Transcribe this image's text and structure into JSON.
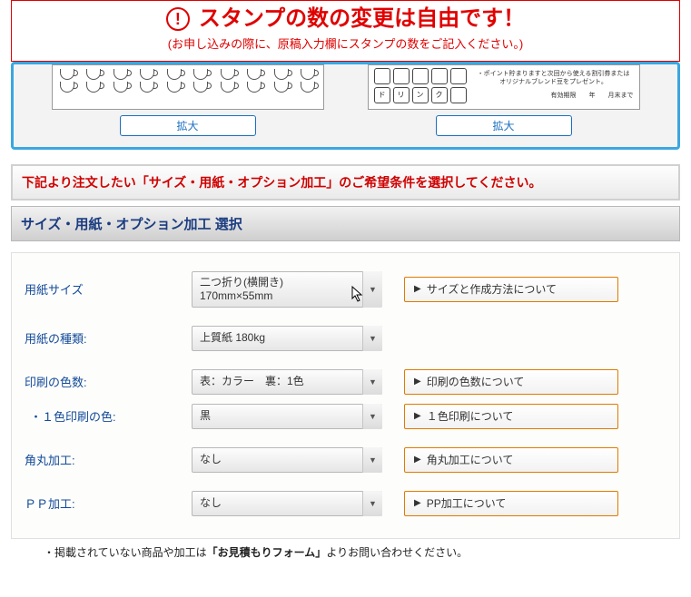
{
  "notice": {
    "title": "スタンプの数の変更は自由です！",
    "subtitle": "(お申し込みの際に、原稿入力欄にスタンプの数をご記入ください。)"
  },
  "preview": {
    "zoom_label": "拡大",
    "card2_squares": [
      "",
      "",
      "",
      "",
      "",
      "ド",
      "リ",
      "ン",
      "ク",
      ""
    ],
    "card2_desc_line1": "・ポイント貯まりますと次回から使える割引券または",
    "card2_desc_line2": "オリジナルブレンド豆をプレゼント。",
    "card2_desc_line3": "有効期限　　年　　月末まで"
  },
  "instruction": "下記より注文したい「サイズ・用紙・オプション加工」のご希望条件を選択してください。",
  "section_title": "サイズ・用紙・オプション加工 選択",
  "form": {
    "size": {
      "label": "用紙サイズ",
      "value": "二つ折り(横開き)\n170mm×55mm",
      "info": "サイズと作成方法について"
    },
    "paper": {
      "label": "用紙の種類:",
      "value": "上質紙 180kg"
    },
    "colors": {
      "label": "印刷の色数:",
      "value": "表：カラー　裏：1色",
      "info": "印刷の色数について"
    },
    "onecolor": {
      "label": "・１色印刷の色:",
      "value": "黒",
      "info": "１色印刷について"
    },
    "round": {
      "label": "角丸加工:",
      "value": "なし",
      "info": "角丸加工について"
    },
    "pp": {
      "label": "ＰＰ加工:",
      "value": "なし",
      "info": "PP加工について"
    }
  },
  "footer_note": {
    "prefix": "・掲載されていない商品や加工は",
    "bold": "「お見積もりフォーム」",
    "suffix": "よりお問い合わせください。"
  }
}
